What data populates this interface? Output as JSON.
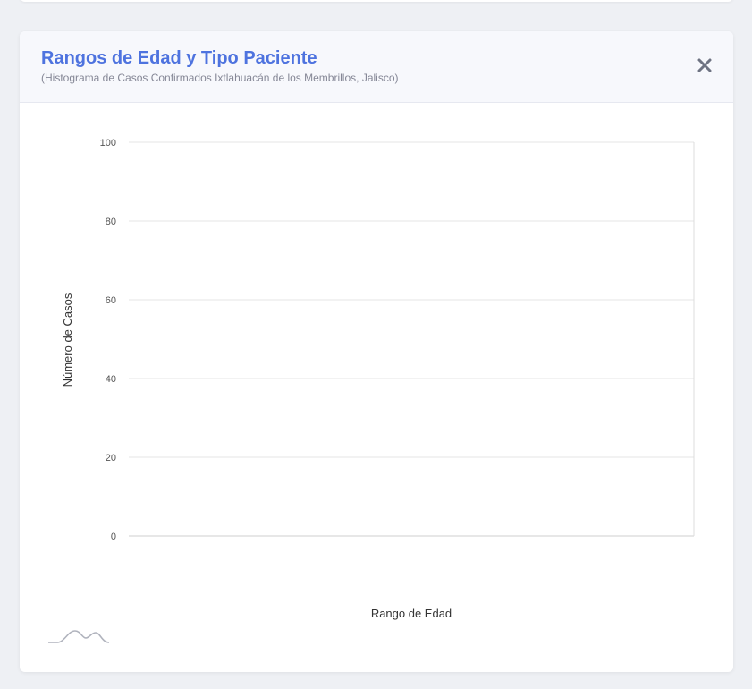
{
  "card": {
    "title": "Rangos de Edad y Tipo Paciente",
    "subtitle": "(Histograma de Casos Confirmados Ixtlahuacán de los Membrillos, Jalisco)",
    "close_icon": "close-icon",
    "brand_icon": "waveform-icon"
  },
  "colors": {
    "title": "#4e73df",
    "subtitle": "#858796",
    "grid": "#e6e6e6",
    "close": "#6e7382"
  },
  "chart_data": {
    "type": "bar",
    "title": "",
    "xlabel": "Rango de Edad",
    "ylabel": "Número de Casos",
    "categories": [],
    "series": [],
    "ylim": [
      0,
      100
    ],
    "yticks": [
      0,
      20,
      40,
      60,
      80,
      100
    ],
    "grid": true,
    "legend": "none"
  }
}
